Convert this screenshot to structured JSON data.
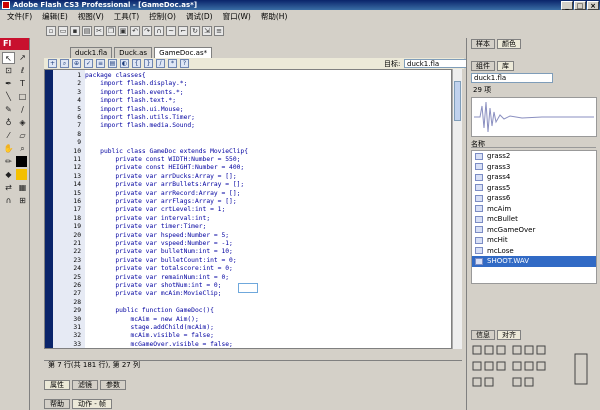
{
  "window": {
    "title": "Adobe Flash CS3 Professional - [GameDoc.as*]",
    "min": "_",
    "max": "□",
    "close": "×"
  },
  "menu": [
    "文件(F)",
    "编辑(E)",
    "视图(V)",
    "工具(T)",
    "控制(O)",
    "调试(D)",
    "窗口(W)",
    "帮助(H)"
  ],
  "tools": {
    "logo": "Fl"
  },
  "doc_tabs": [
    "duck1.fla",
    "Duck.as",
    "GameDoc.as*"
  ],
  "editor": {
    "target_label": "目标:",
    "target_value": "duck1.fla",
    "lines": [
      {
        "n": "1",
        "code": "package classes{"
      },
      {
        "n": "2",
        "code": "    import flash.display.*;"
      },
      {
        "n": "3",
        "code": "    import flash.events.*;"
      },
      {
        "n": "4",
        "code": "    import flash.text.*;"
      },
      {
        "n": "5",
        "code": "    import flash.ui.Mouse;"
      },
      {
        "n": "6",
        "code": "    import flash.utils.Timer;"
      },
      {
        "n": "7",
        "code": "    import flash.media.Sound;"
      },
      {
        "n": "8",
        "code": ""
      },
      {
        "n": "9",
        "code": ""
      },
      {
        "n": "10",
        "code": "    public class GameDoc extends MovieClip{"
      },
      {
        "n": "11",
        "code": "        private const WIDTH:Number = 550;"
      },
      {
        "n": "12",
        "code": "        private const HEIGHT:Number = 400;"
      },
      {
        "n": "13",
        "code": "        private var arrDucks:Array = [];"
      },
      {
        "n": "14",
        "code": "        private var arrBullets:Array = [];"
      },
      {
        "n": "15",
        "code": "        private var arrRecord:Array = [];"
      },
      {
        "n": "16",
        "code": "        private var arrFlags:Array = [];"
      },
      {
        "n": "17",
        "code": "        private var crtLevel:int = 1;"
      },
      {
        "n": "18",
        "code": "        private var interval:int;"
      },
      {
        "n": "19",
        "code": "        private var timer:Timer;"
      },
      {
        "n": "20",
        "code": "        private var hspeed:Number = 5;"
      },
      {
        "n": "21",
        "code": "        private var vspeed:Number = -1;"
      },
      {
        "n": "22",
        "code": "        private var bulletNum:int = 10;"
      },
      {
        "n": "23",
        "code": "        private var bulletCount:int = 0;"
      },
      {
        "n": "24",
        "code": "        private var totalscore:int = 0;"
      },
      {
        "n": "25",
        "code": "        private var remainNum:int = 0;"
      },
      {
        "n": "26",
        "code": "        private var shotNum:int = 0;"
      },
      {
        "n": "27",
        "code": "        private var mcAim:MovieClip;"
      },
      {
        "n": "28",
        "code": ""
      },
      {
        "n": "29",
        "code": "        public function GameDoc(){"
      },
      {
        "n": "30",
        "code": "            mcAim = new Aim();"
      },
      {
        "n": "31",
        "code": "            stage.addChild(mcAim);"
      },
      {
        "n": "32",
        "code": "            mcAim.visible = false;"
      },
      {
        "n": "33",
        "code": "            mcGameOver.visible = false;"
      }
    ],
    "status": "第 7 行(共 181 行), 第 27 列"
  },
  "bottom_tabs_1": [
    "属性",
    "滤镜",
    "参数"
  ],
  "bottom_tabs_2": [
    "帮助",
    "动作 - 帧"
  ],
  "right": {
    "top_tabs": [
      "样本",
      "颜色"
    ],
    "library_tabs": [
      "组件",
      "库"
    ],
    "library_file": "duck1.fla",
    "item_count": "29 项",
    "name_header": "名称",
    "items": [
      "grass2",
      "grass3",
      "grass4",
      "grass5",
      "grass6",
      "mcAim",
      "mcBullet",
      "mcGameOver",
      "mcHit",
      "mcLose",
      "SHOOT.WAV"
    ],
    "selected_item": "SHOOT.WAV",
    "align_tabs": [
      "信息",
      "对齐"
    ]
  },
  "colors": {
    "title_bar": "#0a246a",
    "gutter": "#0a246a",
    "code_text": "#0000a0",
    "selection": "#316ac5",
    "logo": "#c8102e"
  }
}
